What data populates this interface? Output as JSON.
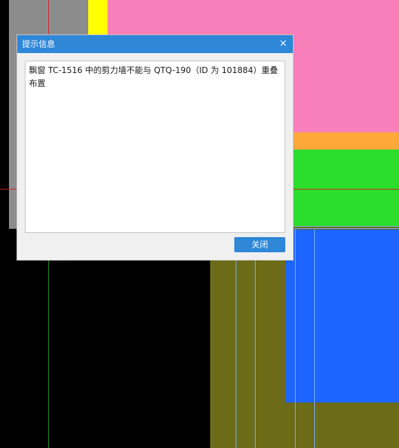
{
  "dialog": {
    "title": "提示信息",
    "close_icon": "×",
    "message": "飘窗 TC-1516 中的剪力墙不能与 QTQ-190（ID 为 101884）重叠布置",
    "close_button_label": "关闭"
  },
  "colors": {
    "background": "#000000",
    "gray_block": "#8c8c8c",
    "yellow_block": "#ffff00",
    "pink_block": "#f87fba",
    "orange_strip": "#ffa83a",
    "green_block": "#2cdd2c",
    "olive_block": "#6b6b18",
    "blue_block": "#1e64ff",
    "light_blue_lines": "#7fb2f0",
    "red_axis": "#cc2222",
    "green_axis": "#1a9a1a",
    "accent": "#2f87d8"
  }
}
